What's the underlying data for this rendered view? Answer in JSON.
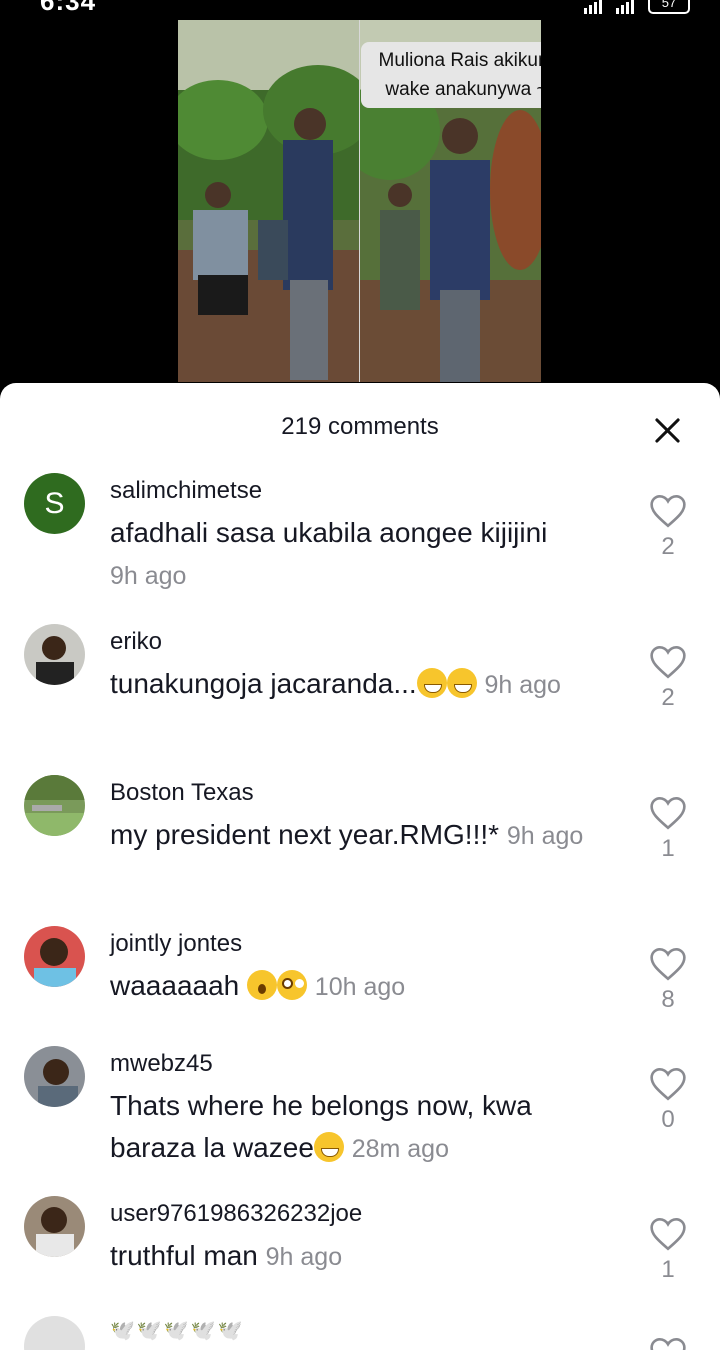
{
  "status": {
    "time": "6:34",
    "battery": "57"
  },
  "video": {
    "caption_line1": "Muliona Rais akikunywa maji, naibu",
    "caption_line2": "wake anakunywa ~ Riggy G 😂🤣"
  },
  "comments_header": {
    "count_label": "219 comments"
  },
  "comments": [
    {
      "avatar_letter": "S",
      "username": "salimchimetse",
      "text": "afadhali sasa ukabila aongee kijijini",
      "time": "9h ago",
      "likes": "2"
    },
    {
      "username": "eriko",
      "text": "tunakungoja jacaranda...",
      "time": "9h ago",
      "likes": "2"
    },
    {
      "username": "Boston Texas",
      "text": "my president next year.RMG!!!*",
      "time": "9h ago",
      "likes": "1"
    },
    {
      "username": "jointly jontes",
      "text": "waaaaaah",
      "time": "10h ago",
      "likes": "8"
    },
    {
      "username": "mwebz45",
      "text": "Thats where he belongs now, kwa baraza la wazee",
      "time": "28m ago",
      "likes": "0"
    },
    {
      "username": "user9761986326232joe",
      "text": "truthful man",
      "time": "9h ago",
      "likes": "1"
    }
  ],
  "partial_comment": {
    "username_glyphs": "🕊️🕊️🕊️🕊️🕊️"
  }
}
